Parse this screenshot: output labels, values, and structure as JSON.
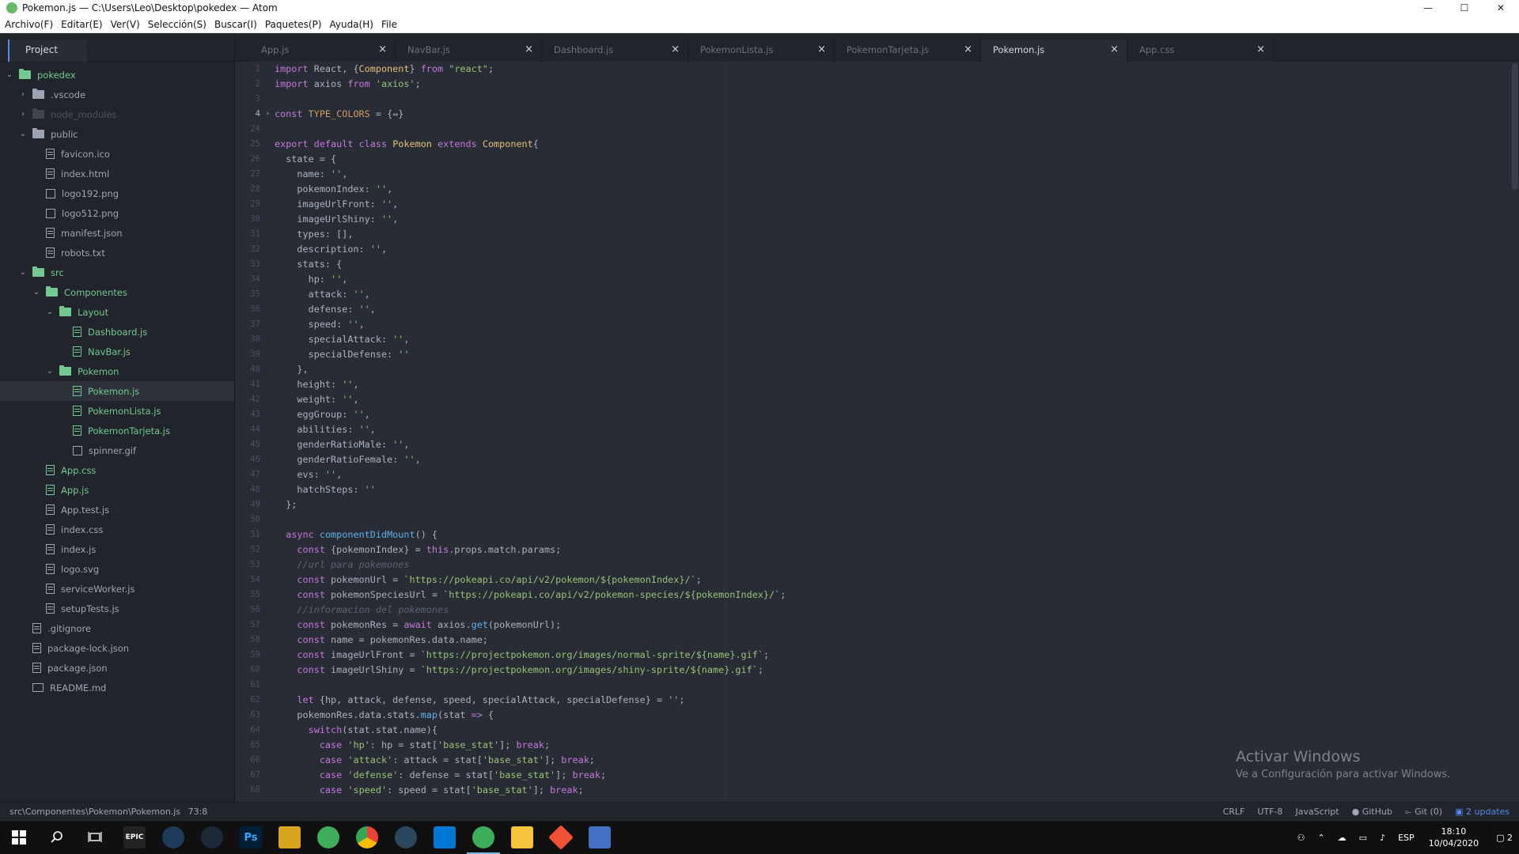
{
  "window": {
    "title": "Pokemon.js — C:\\Users\\Leo\\Desktop\\pokedex — Atom",
    "minimize": "—",
    "maximize": "☐",
    "close": "✕"
  },
  "menu": [
    "Archivo(F)",
    "Editar(E)",
    "Ver(V)",
    "Selección(S)",
    "Buscar(I)",
    "Paquetes(P)",
    "Ayuda(H)",
    "File"
  ],
  "sidebar": {
    "panel_title": "Project",
    "tree": [
      {
        "label": "pokedex"
      },
      {
        "label": ".vscode"
      },
      {
        "label": "node_modules"
      },
      {
        "label": "public"
      },
      {
        "label": "favicon.ico"
      },
      {
        "label": "index.html"
      },
      {
        "label": "logo192.png"
      },
      {
        "label": "logo512.png"
      },
      {
        "label": "manifest.json"
      },
      {
        "label": "robots.txt"
      },
      {
        "label": "src"
      },
      {
        "label": "Componentes"
      },
      {
        "label": "Layout"
      },
      {
        "label": "Dashboard.js"
      },
      {
        "label": "NavBar.js"
      },
      {
        "label": "Pokemon"
      },
      {
        "label": "Pokemon.js"
      },
      {
        "label": "PokemonLista.js"
      },
      {
        "label": "PokemonTarjeta.js"
      },
      {
        "label": "spinner.gif"
      },
      {
        "label": "App.css"
      },
      {
        "label": "App.js"
      },
      {
        "label": "App.test.js"
      },
      {
        "label": "index.css"
      },
      {
        "label": "index.js"
      },
      {
        "label": "logo.svg"
      },
      {
        "label": "serviceWorker.js"
      },
      {
        "label": "setupTests.js"
      },
      {
        "label": ".gitignore"
      },
      {
        "label": "package-lock.json"
      },
      {
        "label": "package.json"
      },
      {
        "label": "README.md"
      }
    ]
  },
  "tabs": [
    "App.js",
    "NavBar.js",
    "Dashboard.js",
    "PokemonLista.js",
    "PokemonTarjeta.js",
    "Pokemon.js",
    "App.css"
  ],
  "tab_close": "×",
  "fold_marker": "›",
  "editor": {
    "line_numbers": [
      "1",
      "2",
      "3",
      "4",
      "24",
      "25",
      "26",
      "27",
      "28",
      "29",
      "30",
      "31",
      "32",
      "33",
      "34",
      "35",
      "36",
      "37",
      "38",
      "39",
      "40",
      "41",
      "42",
      "43",
      "44",
      "45",
      "46",
      "47",
      "48",
      "49",
      "50",
      "51",
      "52",
      "53",
      "54",
      "55",
      "56",
      "57",
      "58",
      "59",
      "60",
      "61",
      "62",
      "63",
      "64",
      "65",
      "66",
      "67",
      "68"
    ],
    "lines": [
      "import React, {Component} from \"react\";",
      "import axios from 'axios';",
      "",
      "const TYPE_COLORS = {⇔}",
      "",
      "export default class Pokemon extends Component{",
      "  state = {",
      "    name: '',",
      "    pokemonIndex: '',",
      "    imageUrlFront: '',",
      "    imageUrlShiny: '',",
      "    types: [],",
      "    description: '',",
      "    stats: {",
      "      hp: '',",
      "      attack: '',",
      "      defense: '',",
      "      speed: '',",
      "      specialAttack: '',",
      "      specialDefense: ''",
      "    },",
      "    height: '',",
      "    weight: '',",
      "    eggGroup: '',",
      "    abilities: '',",
      "    genderRatioMale: '',",
      "    genderRatioFemale: '',",
      "    evs: '',",
      "    hatchSteps: ''",
      "  };",
      "",
      "  async componentDidMount() {",
      "    const {pokemonIndex} = this.props.match.params;",
      "    //url para pokemones",
      "    const pokemonUrl = `https://pokeapi.co/api/v2/pokemon/${pokemonIndex}/`;",
      "    const pokemonSpeciesUrl = `https://pokeapi.co/api/v2/pokemon-species/${pokemonIndex}/`;",
      "    //informacion del pokemones",
      "    const pokemonRes = await axios.get(pokemonUrl);",
      "    const name = pokemonRes.data.name;",
      "    const imageUrlFront = `https://projectpokemon.org/images/normal-sprite/${name}.gif`;",
      "    const imageUrlShiny = `https://projectpokemon.org/images/shiny-sprite/${name}.gif`;",
      "",
      "    let {hp, attack, defense, speed, specialAttack, specialDefense} = '';",
      "    pokemonRes.data.stats.map(stat => {",
      "      switch(stat.stat.name){",
      "        case 'hp': hp = stat['base_stat']; break;",
      "        case 'attack': attack = stat['base_stat']; break;",
      "        case 'defense': defense = stat['base_stat']; break;",
      "        case 'speed': speed = stat['base_stat']; break;"
    ]
  },
  "watermark": {
    "title": "Activar Windows",
    "subtitle": "Ve a Configuración para activar Windows."
  },
  "status": {
    "path": "src\\Componentes\\Pokemon\\Pokemon.js",
    "cursor": "73:8",
    "line_ending": "CRLF",
    "encoding": "UTF-8",
    "grammar": "JavaScript",
    "github": "GitHub",
    "git": "Git (0)",
    "updates": "2 updates"
  },
  "taskbar": {
    "lang": "ESP",
    "time": "18:10",
    "date": "10/04/2020",
    "notifications": "2"
  },
  "colors": {
    "accent": "#568af2",
    "git_added": "#73c990"
  }
}
